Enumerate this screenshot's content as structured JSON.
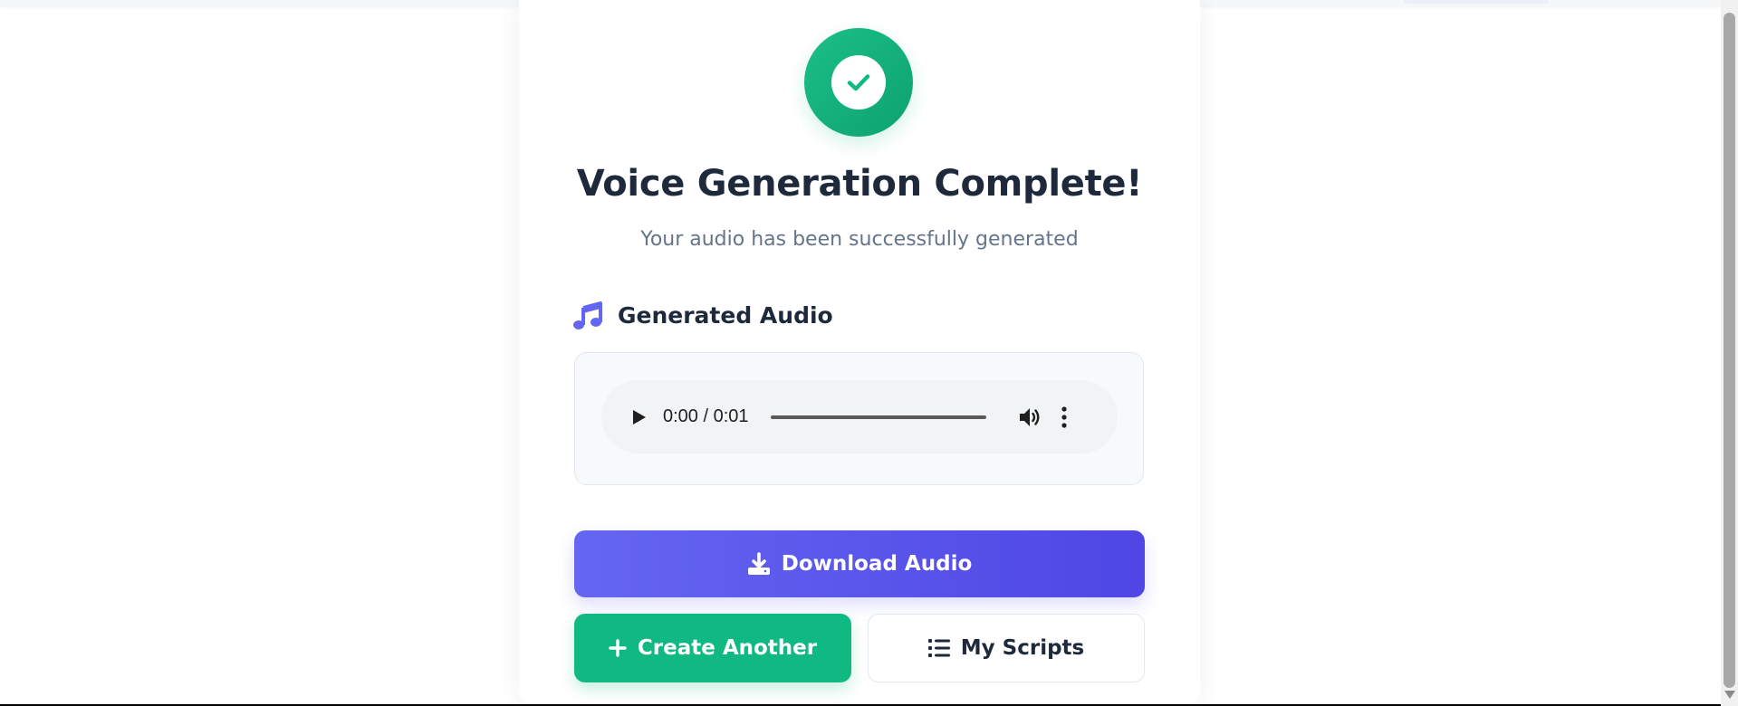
{
  "result": {
    "title": "Voice Generation Complete!",
    "subtitle": "Your audio has been successfully generated",
    "status_icon": "check-circle-icon",
    "status_color": "#10b981"
  },
  "audio": {
    "section_title": "Generated Audio",
    "section_icon": "music-note-icon",
    "section_icon_color": "#6366f1",
    "player": {
      "time_display": "0:00 / 0:01",
      "current_time": "0:00",
      "duration": "0:01"
    }
  },
  "actions": {
    "download_label": "Download Audio",
    "download_icon": "download-icon",
    "download_color": "#5b57ee",
    "create_label": "Create Another",
    "create_icon": "plus-icon",
    "create_color": "#10b981",
    "scripts_label": "My Scripts",
    "scripts_icon": "list-icon"
  }
}
